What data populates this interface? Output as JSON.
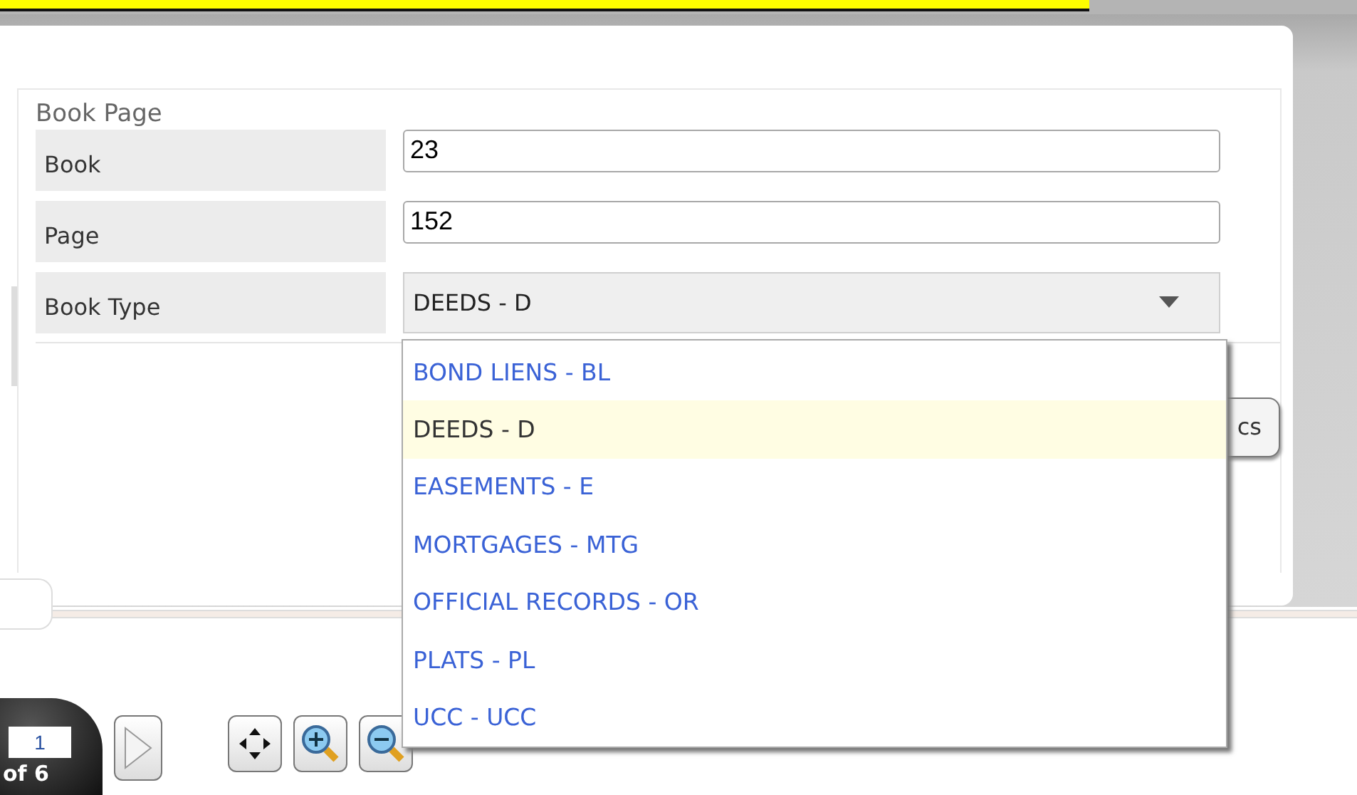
{
  "form": {
    "legend": "Book Page",
    "fields": [
      {
        "label": "Book",
        "kind": "text",
        "value": "23"
      },
      {
        "label": "Page",
        "kind": "text",
        "value": "152"
      },
      {
        "label": "Book Type",
        "kind": "select",
        "value": "DEEDS - D",
        "expanded": true
      }
    ]
  },
  "dropdown": {
    "options": [
      {
        "label": "BOND LIENS - BL",
        "selected": false
      },
      {
        "label": "DEEDS - D",
        "selected": true
      },
      {
        "label": "EASEMENTS - E",
        "selected": false
      },
      {
        "label": "MORTGAGES - MTG",
        "selected": false
      },
      {
        "label": "OFFICIAL RECORDS - OR",
        "selected": false
      },
      {
        "label": "PLATS - PL",
        "selected": false
      },
      {
        "label": "UCC - UCC",
        "selected": false
      }
    ]
  },
  "partial_button": {
    "label": "cs"
  },
  "pager": {
    "page": "1",
    "total": "of 6"
  }
}
